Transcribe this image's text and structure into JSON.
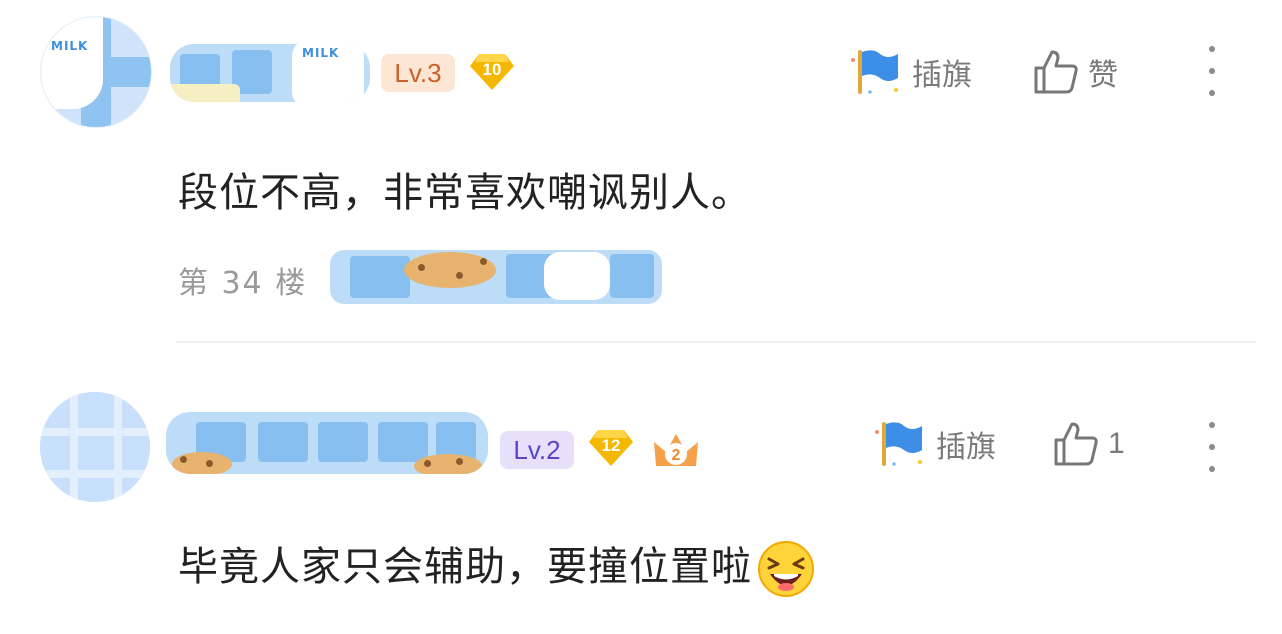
{
  "comments": [
    {
      "level": "Lv.3",
      "gem_level": "10",
      "actions": {
        "flag_label": "插旗",
        "like_label": "赞"
      },
      "text": "段位不高，非常喜欢嘲讽别人。",
      "floor": "第 34 楼",
      "avatar_text": "MILK",
      "name_watermark": "MILK"
    },
    {
      "level": "Lv.2",
      "gem_level": "12",
      "crown_level": "2",
      "actions": {
        "flag_label": "插旗",
        "like_count": "1"
      },
      "text": "毕竟人家只会辅助，要撞位置啦"
    }
  ],
  "colors": {
    "lv3_bg": "#fde6d3",
    "lv3_text": "#c9622a",
    "lv2_bg": "#e6e0fb",
    "lv2_text": "#5c46c8",
    "gem": "#f5b800",
    "flag": "#3c8ee6"
  },
  "icons": {
    "flag": "flag-icon",
    "like": "thumbs-up-icon",
    "more": "more-vertical-icon",
    "emoji": "laughing-emoji-icon"
  }
}
